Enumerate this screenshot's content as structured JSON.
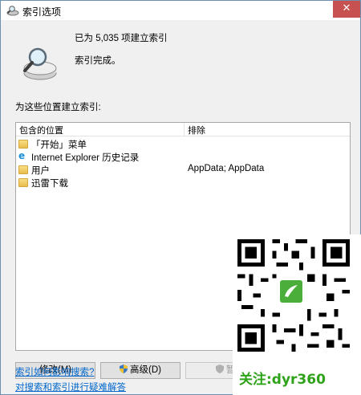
{
  "window": {
    "title": "索引选项",
    "close_glyph": "✕"
  },
  "status": {
    "count_text": "已为 5,035 项建立索引",
    "state_text": "索引完成。"
  },
  "locations": {
    "section_label": "为这些位置建立索引:",
    "col_included": "包含的位置",
    "col_exclude": "排除",
    "rows": [
      {
        "icon": "folder-icon",
        "name": "「开始」菜单",
        "exclude": ""
      },
      {
        "icon": "internet-explorer-icon",
        "name": "Internet Explorer 历史记录",
        "exclude": ""
      },
      {
        "icon": "folder-icon",
        "name": "用户",
        "exclude": "AppData; AppData"
      },
      {
        "icon": "folder-icon",
        "name": "迅雷下载",
        "exclude": ""
      }
    ]
  },
  "buttons": {
    "modify": "修改(M)",
    "advanced": "高级(D)",
    "third_partial": "暂"
  },
  "links": {
    "how_affects": "索引如何影响搜索?",
    "troubleshoot": "对搜索和索引进行疑难解答"
  },
  "watermark": {
    "text": "关注:dyr360"
  },
  "colors": {
    "link": "#0066cc",
    "watermark": "#2ea319",
    "close_red": "#c75050"
  }
}
